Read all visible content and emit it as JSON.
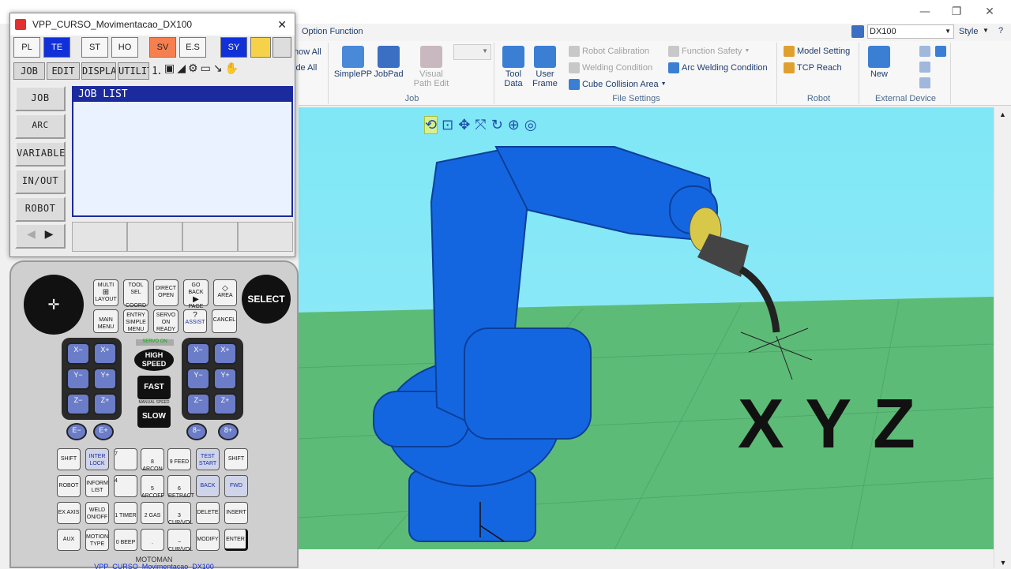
{
  "main_window": {
    "ribbon_tab": "Option Function",
    "controller_select": "DX100",
    "style_menu": "Style",
    "win_controls": {
      "minimize": "—",
      "restore": "❐",
      "close": "✕"
    },
    "partial_show_all": "how All",
    "partial_hide_all": "ide All",
    "groups": {
      "job": {
        "label": "Job",
        "simplepp": "SimplePP",
        "jobpad": "JobPad",
        "visual_path_edit_l1": "Visual",
        "visual_path_edit_l2": "Path Edit"
      },
      "file_settings": {
        "label": "File Settings",
        "tool_data_l1": "Tool",
        "tool_data_l2": "Data",
        "user_frame_l1": "User",
        "user_frame_l2": "Frame",
        "robot_calibration": "Robot Calibration",
        "welding_condition": "Welding Condition",
        "cube_collision_area": "Cube Collision Area",
        "function_safety": "Function Safety",
        "arc_welding_condition": "Arc Welding Condition"
      },
      "robot": {
        "label": "Robot",
        "model_setting": "Model Setting",
        "tcp_reach": "TCP Reach"
      },
      "external_device": {
        "label": "External Device",
        "new": "New"
      }
    },
    "viewport": {
      "overlay_text": "X Y Z"
    }
  },
  "pendant_window": {
    "title": "VPP_CURSO_Movimentacao_DX100",
    "close": "✕",
    "top_buttons": [
      {
        "label": "PL",
        "color": "#ffffff"
      },
      {
        "label": "TE",
        "color": "#1030d8"
      },
      {
        "label": "ST",
        "color": "#ffffff"
      },
      {
        "label": "HO",
        "color": "#ffffff"
      },
      {
        "label": "SV",
        "color": "#f57f4f"
      },
      {
        "label": "E.S",
        "color": "#ffffff"
      },
      {
        "label": "SY",
        "color": "#1030d8"
      }
    ],
    "menu": [
      "JOB",
      "EDIT",
      "DISPLAY",
      "UTILITY"
    ],
    "side_menu": [
      "JOB",
      "ARC WELDING",
      "VARIABLE",
      "IN/OUT",
      "ROBOT"
    ],
    "job_list_title": "JOB LIST"
  },
  "keypad": {
    "select": "SELECT",
    "multi": "MULTI",
    "layout": "LAYOUT",
    "coord": "COORD",
    "tool_sel": "TOOL SEL",
    "direct_open": "DIRECT OPEN",
    "go_back": "GO BACK",
    "page": "PAGE",
    "area": "AREA",
    "main_menu": "MAIN MENU",
    "entry": "ENTRY",
    "simple_menu": "SIMPLE MENU",
    "servo_on_ready": "SERVO ON READY",
    "assist": "ASSIST",
    "cancel": "CANCEL",
    "servo_on": "SERVO ON",
    "high_speed": "HIGH SPEED",
    "fast": "FAST",
    "manual_speed": "MANUAL SPEED",
    "slow": "SLOW",
    "jog_left": [
      "X−",
      "X+",
      "Y−",
      "Y+",
      "Z−",
      "Z+"
    ],
    "jog_right": [
      "X−",
      "X+",
      "Y−",
      "Y+",
      "Z−",
      "Z+"
    ],
    "e_minus": "E−",
    "e_plus": "E+",
    "b8_minus": "8−",
    "b8_plus": "8+",
    "row1": [
      "SHIFT",
      "INTER LOCK",
      "7",
      "8 ARCON",
      "9 FEED",
      "TEST START",
      "SHIFT"
    ],
    "row2": [
      "ROBOT",
      "INFORM LIST",
      "4",
      "5 ARCOFF",
      "6 RETRACT",
      "BACK",
      "FWD"
    ],
    "row3": [
      "EX AXIS",
      "WELD ON/OFF",
      "1 TIMER",
      "2 GAS",
      "3 CUR/VOL",
      "DELETE",
      "INSERT"
    ],
    "row4": [
      "AUX",
      "MOTION TYPE",
      "0 BEEP",
      ".",
      "− CUR/VOL",
      "MODIFY",
      "ENTER"
    ],
    "brand": "MOTOMAN",
    "footer": "VPP_CURSO_Movimentacao_DX100"
  }
}
